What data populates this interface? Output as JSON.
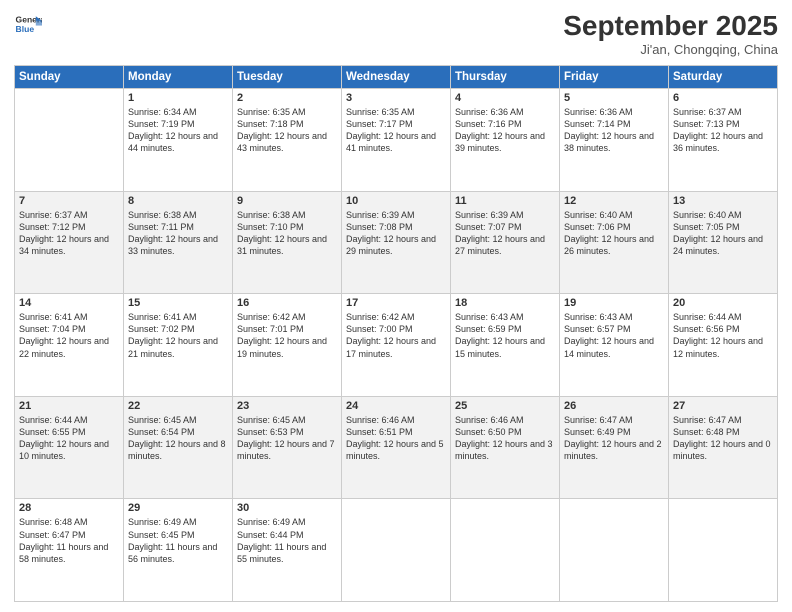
{
  "header": {
    "logo_line1": "General",
    "logo_line2": "Blue",
    "month": "September 2025",
    "location": "Ji'an, Chongqing, China"
  },
  "weekdays": [
    "Sunday",
    "Monday",
    "Tuesday",
    "Wednesday",
    "Thursday",
    "Friday",
    "Saturday"
  ],
  "weeks": [
    [
      {
        "day": "",
        "info": ""
      },
      {
        "day": "1",
        "info": "Sunrise: 6:34 AM\nSunset: 7:19 PM\nDaylight: 12 hours\nand 44 minutes."
      },
      {
        "day": "2",
        "info": "Sunrise: 6:35 AM\nSunset: 7:18 PM\nDaylight: 12 hours\nand 43 minutes."
      },
      {
        "day": "3",
        "info": "Sunrise: 6:35 AM\nSunset: 7:17 PM\nDaylight: 12 hours\nand 41 minutes."
      },
      {
        "day": "4",
        "info": "Sunrise: 6:36 AM\nSunset: 7:16 PM\nDaylight: 12 hours\nand 39 minutes."
      },
      {
        "day": "5",
        "info": "Sunrise: 6:36 AM\nSunset: 7:14 PM\nDaylight: 12 hours\nand 38 minutes."
      },
      {
        "day": "6",
        "info": "Sunrise: 6:37 AM\nSunset: 7:13 PM\nDaylight: 12 hours\nand 36 minutes."
      }
    ],
    [
      {
        "day": "7",
        "info": "Sunrise: 6:37 AM\nSunset: 7:12 PM\nDaylight: 12 hours\nand 34 minutes."
      },
      {
        "day": "8",
        "info": "Sunrise: 6:38 AM\nSunset: 7:11 PM\nDaylight: 12 hours\nand 33 minutes."
      },
      {
        "day": "9",
        "info": "Sunrise: 6:38 AM\nSunset: 7:10 PM\nDaylight: 12 hours\nand 31 minutes."
      },
      {
        "day": "10",
        "info": "Sunrise: 6:39 AM\nSunset: 7:08 PM\nDaylight: 12 hours\nand 29 minutes."
      },
      {
        "day": "11",
        "info": "Sunrise: 6:39 AM\nSunset: 7:07 PM\nDaylight: 12 hours\nand 27 minutes."
      },
      {
        "day": "12",
        "info": "Sunrise: 6:40 AM\nSunset: 7:06 PM\nDaylight: 12 hours\nand 26 minutes."
      },
      {
        "day": "13",
        "info": "Sunrise: 6:40 AM\nSunset: 7:05 PM\nDaylight: 12 hours\nand 24 minutes."
      }
    ],
    [
      {
        "day": "14",
        "info": "Sunrise: 6:41 AM\nSunset: 7:04 PM\nDaylight: 12 hours\nand 22 minutes."
      },
      {
        "day": "15",
        "info": "Sunrise: 6:41 AM\nSunset: 7:02 PM\nDaylight: 12 hours\nand 21 minutes."
      },
      {
        "day": "16",
        "info": "Sunrise: 6:42 AM\nSunset: 7:01 PM\nDaylight: 12 hours\nand 19 minutes."
      },
      {
        "day": "17",
        "info": "Sunrise: 6:42 AM\nSunset: 7:00 PM\nDaylight: 12 hours\nand 17 minutes."
      },
      {
        "day": "18",
        "info": "Sunrise: 6:43 AM\nSunset: 6:59 PM\nDaylight: 12 hours\nand 15 minutes."
      },
      {
        "day": "19",
        "info": "Sunrise: 6:43 AM\nSunset: 6:57 PM\nDaylight: 12 hours\nand 14 minutes."
      },
      {
        "day": "20",
        "info": "Sunrise: 6:44 AM\nSunset: 6:56 PM\nDaylight: 12 hours\nand 12 minutes."
      }
    ],
    [
      {
        "day": "21",
        "info": "Sunrise: 6:44 AM\nSunset: 6:55 PM\nDaylight: 12 hours\nand 10 minutes."
      },
      {
        "day": "22",
        "info": "Sunrise: 6:45 AM\nSunset: 6:54 PM\nDaylight: 12 hours\nand 8 minutes."
      },
      {
        "day": "23",
        "info": "Sunrise: 6:45 AM\nSunset: 6:53 PM\nDaylight: 12 hours\nand 7 minutes."
      },
      {
        "day": "24",
        "info": "Sunrise: 6:46 AM\nSunset: 6:51 PM\nDaylight: 12 hours\nand 5 minutes."
      },
      {
        "day": "25",
        "info": "Sunrise: 6:46 AM\nSunset: 6:50 PM\nDaylight: 12 hours\nand 3 minutes."
      },
      {
        "day": "26",
        "info": "Sunrise: 6:47 AM\nSunset: 6:49 PM\nDaylight: 12 hours\nand 2 minutes."
      },
      {
        "day": "27",
        "info": "Sunrise: 6:47 AM\nSunset: 6:48 PM\nDaylight: 12 hours\nand 0 minutes."
      }
    ],
    [
      {
        "day": "28",
        "info": "Sunrise: 6:48 AM\nSunset: 6:47 PM\nDaylight: 11 hours\nand 58 minutes."
      },
      {
        "day": "29",
        "info": "Sunrise: 6:49 AM\nSunset: 6:45 PM\nDaylight: 11 hours\nand 56 minutes."
      },
      {
        "day": "30",
        "info": "Sunrise: 6:49 AM\nSunset: 6:44 PM\nDaylight: 11 hours\nand 55 minutes."
      },
      {
        "day": "",
        "info": ""
      },
      {
        "day": "",
        "info": ""
      },
      {
        "day": "",
        "info": ""
      },
      {
        "day": "",
        "info": ""
      }
    ]
  ]
}
